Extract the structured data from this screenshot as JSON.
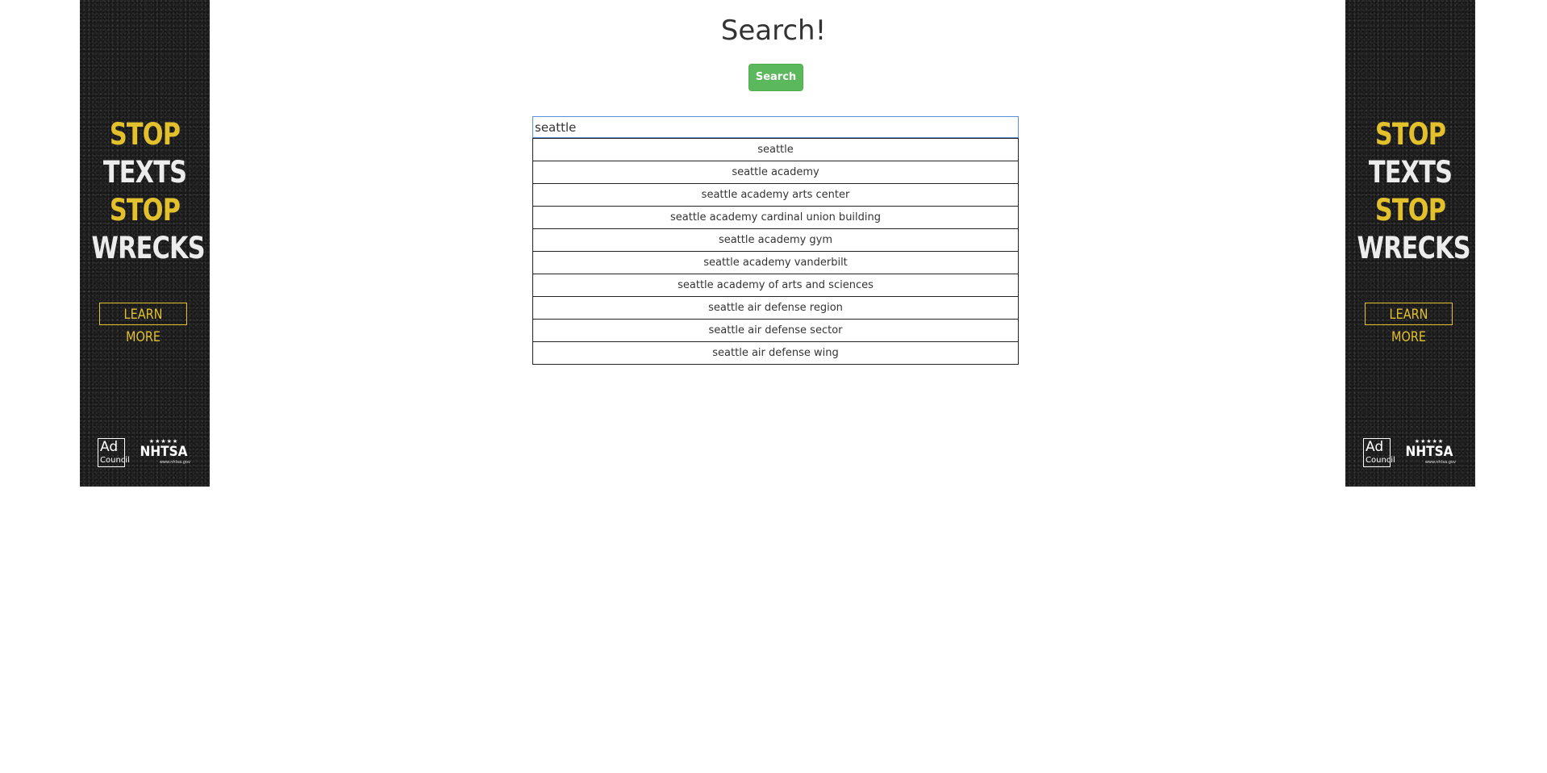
{
  "title": "Search!",
  "search_button_label": "Search",
  "search": {
    "value": "seattle"
  },
  "suggestions": [
    "seattle",
    "seattle academy",
    "seattle academy arts center",
    "seattle academy cardinal union building",
    "seattle academy gym",
    "seattle academy vanderbilt",
    "seattle academy of arts and sciences",
    "seattle air defense region",
    "seattle air defense sector",
    "seattle air defense wing"
  ],
  "ad": {
    "line1": "STOP",
    "line2": "TEXTS",
    "line3": "STOP",
    "line4": "WRECKS",
    "learn_more": "LEARN MORE",
    "adcouncil_ad": "Ad",
    "adcouncil_council": "Council",
    "nhtsa_stars": "★★★★★",
    "nhtsa_name": "NHTSA",
    "nhtsa_url": "www.nhtsa.gov",
    "colors": {
      "accent_yellow": "#e3c12c",
      "text_white": "#ececec",
      "background": "#1d1d1d"
    }
  },
  "colors": {
    "button_green": "#5cb85c",
    "input_focus_border": "#5b8fd9"
  }
}
